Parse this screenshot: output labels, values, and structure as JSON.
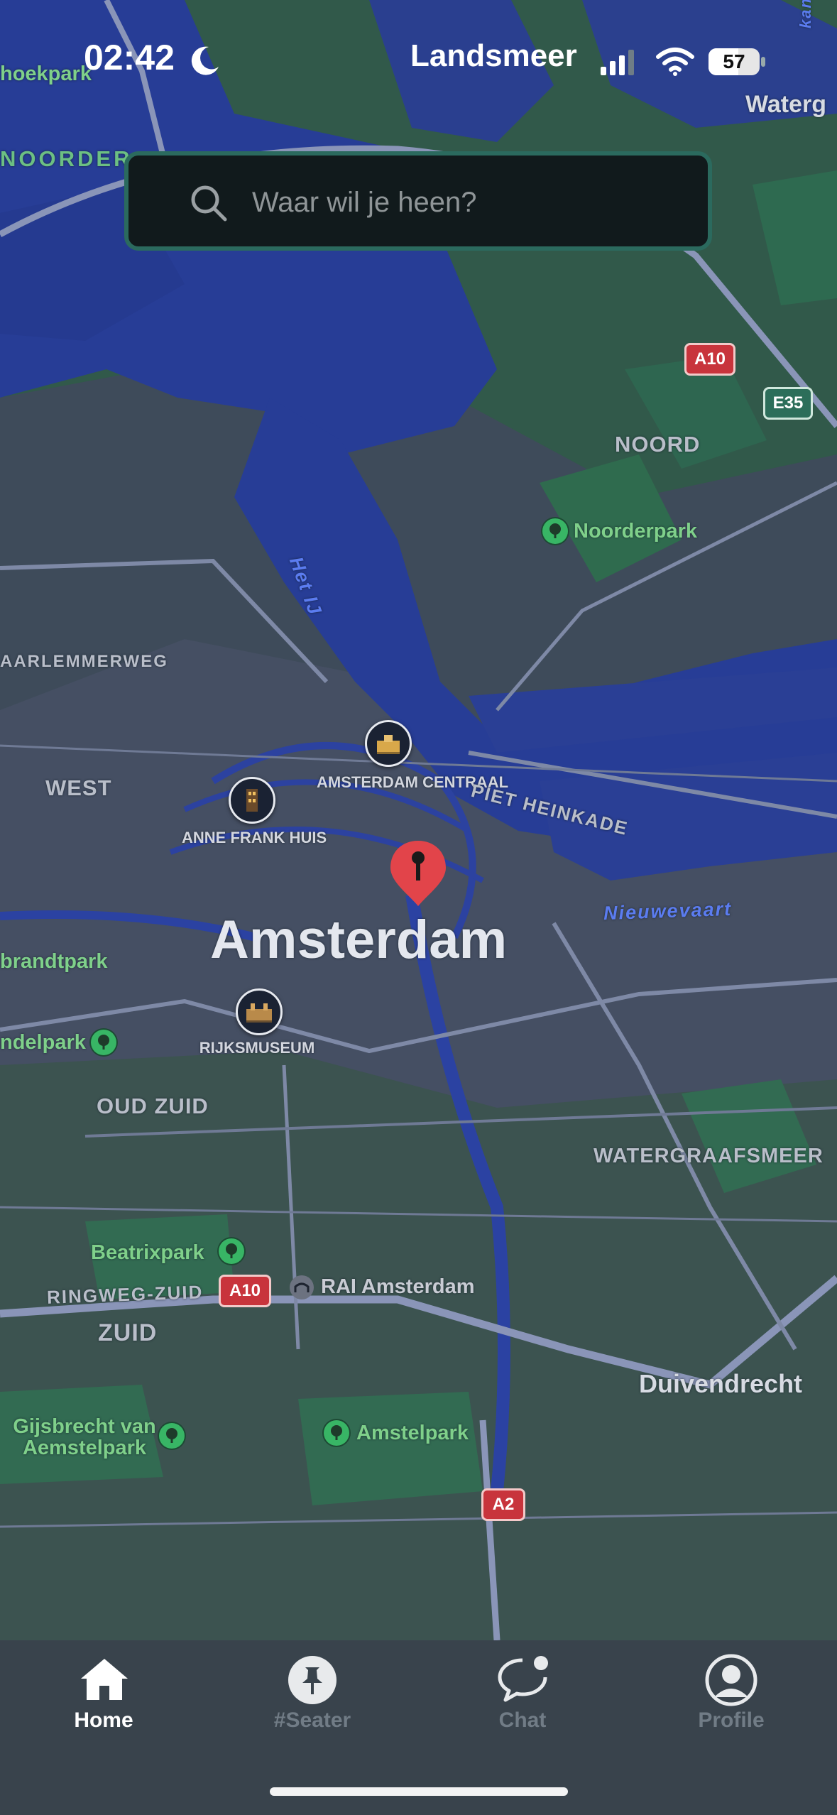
{
  "status_bar": {
    "time": "02:42",
    "carrier": "Landsmeer",
    "battery": "57"
  },
  "search": {
    "placeholder": "Waar wil je heen?"
  },
  "map": {
    "city_label": "Amsterdam",
    "districts": {
      "noord": "NOORD",
      "west": "WEST",
      "oud_zuid": "OUD ZUID",
      "watergraafsmeer": "WATERGRAAFSMEER",
      "zuid": "ZUID",
      "noorder": "NOORDER",
      "duivendrecht": "Duivendrecht",
      "waterg": "Waterg"
    },
    "parks": {
      "noorderpark": "Noorderpark",
      "beatrixpark": "Beatrixpark",
      "amstelpark": "Amstelpark",
      "gijsbrecht": "Gijsbrecht van Aemstelpark",
      "brandtpark": "brandtpark",
      "ndelpark": "ndelpark",
      "hoekpark": "hoekpark"
    },
    "water": {
      "het_ij": "Het IJ",
      "nieuwevaart": "Nieuwevaart",
      "kanaal": "kanaal"
    },
    "roads": {
      "haarlemmerweg": "AARLEMMERWEG",
      "piet_heinkade": "PIET HEINKADE",
      "ringweg_zuid": "RINGWEG-ZUID"
    },
    "shields": {
      "a10_north": "A10",
      "e35": "E35",
      "a10_south": "A10",
      "a2": "A2"
    },
    "pois": {
      "centraal": "AMSTERDAM CENTRAAL",
      "anne_frank": "ANNE FRANK HUIS",
      "rijksmuseum": "RIJKSMUSEUM",
      "rai": "RAI Amsterdam"
    }
  },
  "tabbar": {
    "tabs": [
      {
        "label": "Home",
        "icon": "home-icon",
        "active": true
      },
      {
        "label": "#Seater",
        "icon": "pin-icon",
        "active": false
      },
      {
        "label": "Chat",
        "icon": "chat-icon",
        "active": false
      },
      {
        "label": "Profile",
        "icon": "profile-icon",
        "active": false
      }
    ]
  },
  "colors": {
    "water": "#273d96",
    "land": "#2f5a4a",
    "active_tab": "#ffffff",
    "inactive_tab": "#717c86",
    "pin": "#e2444a"
  }
}
